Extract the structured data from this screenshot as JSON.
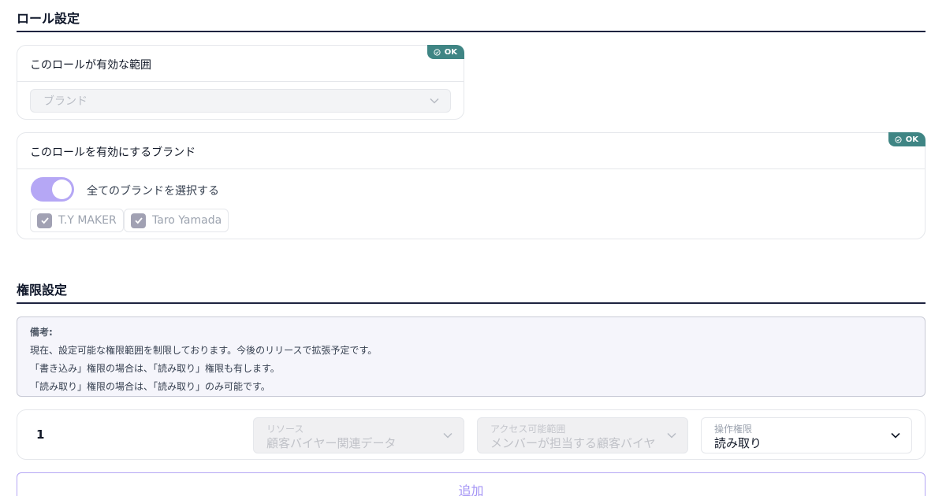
{
  "role_section": {
    "title": "ロール設定",
    "scope_card": {
      "label": "このロールが有効な範囲",
      "badge": "OK",
      "select_value": "ブランド"
    },
    "brand_card": {
      "label": "このロールを有効にするブランド",
      "badge": "OK",
      "toggle_label": "全てのブランドを選択する",
      "toggle_on": true,
      "brands": [
        "T.Y MAKER",
        "Taro Yamada"
      ]
    }
  },
  "permission_section": {
    "title": "権限設定",
    "note": {
      "title": "備考:",
      "lines": [
        "現在、設定可能な権限範囲を制限しております。今後のリリースで拡張予定です。",
        "「書き込み」権限の場合は、「読み取り」権限も有します。",
        "「読み取り」権限の場合は、「読み取り」のみ可能です。"
      ]
    },
    "rows": [
      {
        "number": "1",
        "resource_label": "リソース",
        "resource_value": "顧客バイヤー関連データ",
        "access_label": "アクセス可能範囲",
        "access_value": "メンバーが担当する顧客バイヤー",
        "operation_label": "操作権限",
        "operation_value": "読み取り"
      }
    ],
    "add_label": "追加"
  },
  "colors": {
    "accent": "#b5a7f5",
    "badge": "#3f8584",
    "rule": "#1e2340"
  }
}
